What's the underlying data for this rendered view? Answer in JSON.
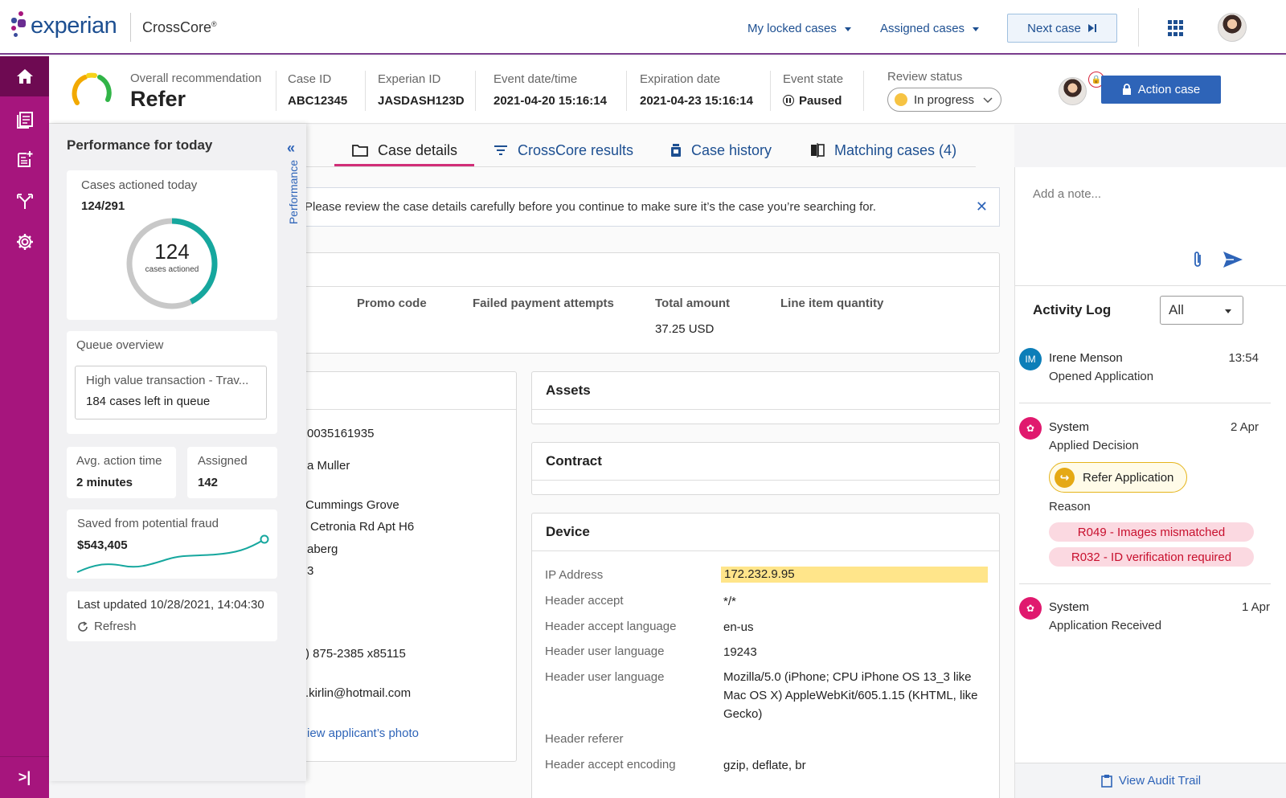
{
  "topbar": {
    "logo_text": "experian",
    "product": "CrossCore",
    "product_mark": "®",
    "my_locked_cases": "My locked cases",
    "assigned_cases": "Assigned cases",
    "next_case": "Next case"
  },
  "case_header": {
    "overall_label": "Overall recommendation",
    "overall_value": "Refer",
    "case_id_label": "Case ID",
    "case_id": "ABC12345",
    "experian_id_label": "Experian ID",
    "experian_id": "JASDASH123D",
    "event_datetime_label": "Event date/time",
    "event_datetime": "2021-04-20 15:16:14",
    "expiration_label": "Expiration date",
    "expiration": "2021-04-23 15:16:14",
    "event_state_label": "Event state",
    "event_state": "Paused",
    "review_status_label": "Review status",
    "review_status": "In progress",
    "action_case": "Action case"
  },
  "tabs": [
    {
      "label": "Case details"
    },
    {
      "label": "CrossCore results"
    },
    {
      "label": "Case history"
    },
    {
      "label": "Matching cases (4)"
    }
  ],
  "banner": {
    "text": "Please review the case details carefully before you continue to make sure it’s the case you’re searching for."
  },
  "transaction": {
    "columns": [
      "Promo code",
      "Failed payment attempts",
      "Total amount",
      "Line item quantity"
    ],
    "total_amount": "37.25 USD"
  },
  "applicant": {
    "lines": [
      "0035161935",
      "a Muller",
      "Cummings Grove",
      "Cetronia Rd Apt H6",
      "aberg",
      "3",
      ") 875-2385 x85115",
      ".kirlin@hotmail.com"
    ],
    "photo_link": "iew applicant’s photo"
  },
  "assets_title": "Assets",
  "contract_title": "Contract",
  "device": {
    "title": "Device",
    "rows": [
      {
        "label": "IP Address",
        "value": "172.232.9.95"
      },
      {
        "label": "Header accept",
        "value": "*/*"
      },
      {
        "label": "Header accept language",
        "value": "en-us"
      },
      {
        "label": "Header user language",
        "value": "19243"
      },
      {
        "label": "Header user language",
        "value": "Mozilla/5.0 (iPhone; CPU iPhone OS 13_3 like Mac OS X) AppleWebKit/605.1.15 (KHTML, like Gecko)"
      },
      {
        "label": "Header referer",
        "value": ""
      },
      {
        "label": "Header accept encoding",
        "value": "gzip, deflate, br"
      }
    ]
  },
  "performance": {
    "title": "Performance for today",
    "tab_label": "Performance",
    "cases_actioned_label": "Cases actioned today",
    "cases_actioned_ratio": "124/291",
    "donut_value": "124",
    "donut_caption": "cases actioned",
    "actioned": 124,
    "total": 291,
    "queue_label": "Queue overview",
    "queue_name": "High value transaction - Trav...",
    "queue_left": "184 cases left in queue",
    "avg_label": "Avg. action time",
    "avg_value": "2 minutes",
    "assigned_label": "Assigned",
    "assigned_value": "142",
    "fraud_label": "Saved from potential fraud",
    "fraud_value": "$543,405",
    "updated": "Last updated 10/28/2021, 14:04:30",
    "refresh": "Refresh"
  },
  "sidebar": {
    "note_placeholder": "Add a note...",
    "activity_title": "Activity Log",
    "filter": "All",
    "log": [
      {
        "initials": "IM",
        "name": "Irene Menson",
        "action": "Opened Application",
        "time": "13:54"
      },
      {
        "name": "System",
        "action": "Applied Decision",
        "time": "2 Apr",
        "decision": "Refer Application",
        "reason_label": "Reason",
        "reasons": [
          "R049 - Images mismatched",
          "R032 - ID verification required"
        ]
      },
      {
        "name": "System",
        "action": "Application Received",
        "time": "1 Apr"
      }
    ],
    "audit": "View Audit Trail"
  },
  "colors": {
    "brand_magenta": "#a6157d",
    "brand_blue": "#1d4f91",
    "accent_teal": "#16a79e",
    "action_blue": "#2e64b8",
    "highlight_yellow": "#ffe58a"
  }
}
